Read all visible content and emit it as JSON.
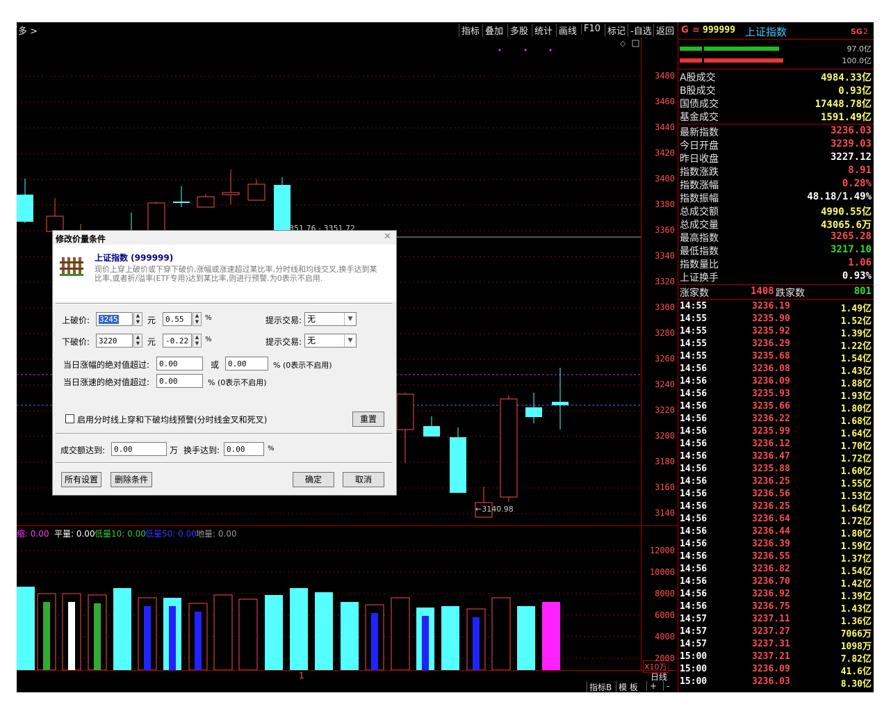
{
  "toolbar": {
    "crumb": "多 >",
    "items": [
      "指标",
      "叠加",
      "多股",
      "统计",
      "画线",
      "F10",
      "标记",
      "-自选",
      "返回"
    ]
  },
  "kchart": {
    "y_ticks": [
      "3480",
      "3460",
      "3440",
      "3420",
      "3400",
      "3380",
      "3360",
      "3340",
      "3320",
      "3300",
      "3280",
      "3260",
      "3240",
      "3220",
      "3200",
      "3180",
      "3160",
      "3140"
    ],
    "high_label": "3351.76 - 3351.72",
    "low_label": "←3140.98"
  },
  "volume": {
    "legend": [
      {
        "text": "缩: 0.00",
        "color": "#ff33ff"
      },
      {
        "text": "平量: 0.00",
        "color": "#ffffff"
      },
      {
        "text": "低量10: 0.00",
        "color": "#33cc33"
      },
      {
        "text": "低量50: 0.00",
        "color": "#3333ff"
      },
      {
        "text": "地量: 0.00",
        "color": "#999999"
      }
    ],
    "y_ticks": [
      "12000",
      "10000",
      "8000",
      "6000",
      "4000",
      "2000"
    ],
    "unit": "X10万"
  },
  "bottom": {
    "page_marker": "1",
    "period": "日线",
    "tabs": [
      "指标B",
      "模 板",
      "+",
      "-"
    ]
  },
  "panel": {
    "header_letter": "G",
    "header_menu": "≡",
    "code": "999999",
    "name": "上证指数",
    "badge": "SG",
    "badge_sub": "2",
    "bar1_value": "97.0亿",
    "bar2_value": "100.0亿",
    "turnover_rows": [
      {
        "label": "A股成交",
        "value": "4984.33亿",
        "color": "#ffff66"
      },
      {
        "label": "B股成交",
        "value": "0.93亿",
        "color": "#ffff66"
      },
      {
        "label": "国债成交",
        "value": "17448.78亿",
        "color": "#ffff66"
      },
      {
        "label": "基金成交",
        "value": "1591.49亿",
        "color": "#ffff66"
      }
    ],
    "stats_rows": [
      {
        "label": "最新指数",
        "value": "3236.03",
        "color": "#ff4d4d"
      },
      {
        "label": "今日开盘",
        "value": "3239.03",
        "color": "#ff4d4d"
      },
      {
        "label": "昨日收盘",
        "value": "3227.12",
        "color": "#ffffff"
      },
      {
        "label": "指数涨跌",
        "value": "8.91",
        "color": "#ff4d4d"
      },
      {
        "label": "指数涨幅",
        "value": "0.28%",
        "color": "#ff4d4d"
      },
      {
        "label": "指数振幅",
        "value": "48.18/1.49%",
        "color": "#ffffff"
      },
      {
        "label": "总成交额",
        "value": "4990.55亿",
        "color": "#ffff66"
      },
      {
        "label": "总成交量",
        "value": "43065.6万",
        "color": "#ffff66"
      },
      {
        "label": "最高指数",
        "value": "3265.28",
        "color": "#ff4d4d"
      },
      {
        "label": "最低指数",
        "value": "3217.10",
        "color": "#33dd33"
      },
      {
        "label": "指数量比",
        "value": "1.06",
        "color": "#ff4d4d"
      },
      {
        "label": "上证换手",
        "value": "0.93%",
        "color": "#ffffff"
      }
    ],
    "up_label": "涨家数",
    "up_count": "1408",
    "down_label": "跌家数",
    "down_count": "801",
    "ticks": [
      {
        "t": "14:55",
        "p": "3236.19",
        "v": "1.49亿"
      },
      {
        "t": "14:55",
        "p": "3235.90",
        "v": "1.52亿"
      },
      {
        "t": "14:55",
        "p": "3235.92",
        "v": "1.39亿"
      },
      {
        "t": "14:55",
        "p": "3236.29",
        "v": "1.22亿"
      },
      {
        "t": "14:55",
        "p": "3235.68",
        "v": "1.54亿"
      },
      {
        "t": "14:56",
        "p": "3236.08",
        "v": "1.43亿"
      },
      {
        "t": "14:56",
        "p": "3236.09",
        "v": "1.88亿"
      },
      {
        "t": "14:56",
        "p": "3235.93",
        "v": "1.93亿"
      },
      {
        "t": "14:56",
        "p": "3235.66",
        "v": "1.80亿"
      },
      {
        "t": "14:56",
        "p": "3236.22",
        "v": "1.68亿"
      },
      {
        "t": "14:56",
        "p": "3235.99",
        "v": "1.64亿"
      },
      {
        "t": "14:56",
        "p": "3236.12",
        "v": "1.70亿"
      },
      {
        "t": "14:56",
        "p": "3236.47",
        "v": "1.72亿"
      },
      {
        "t": "14:56",
        "p": "3235.88",
        "v": "1.60亿"
      },
      {
        "t": "14:56",
        "p": "3236.25",
        "v": "1.55亿"
      },
      {
        "t": "14:56",
        "p": "3236.56",
        "v": "1.53亿"
      },
      {
        "t": "14:56",
        "p": "3236.25",
        "v": "1.64亿"
      },
      {
        "t": "14:56",
        "p": "3236.64",
        "v": "1.72亿"
      },
      {
        "t": "14:56",
        "p": "3236.44",
        "v": "1.80亿"
      },
      {
        "t": "14:56",
        "p": "3236.39",
        "v": "1.59亿"
      },
      {
        "t": "14:56",
        "p": "3236.55",
        "v": "1.37亿"
      },
      {
        "t": "14:56",
        "p": "3236.82",
        "v": "1.54亿"
      },
      {
        "t": "14:56",
        "p": "3236.70",
        "v": "1.42亿"
      },
      {
        "t": "14:56",
        "p": "3236.92",
        "v": "1.39亿"
      },
      {
        "t": "14:56",
        "p": "3236.75",
        "v": "1.43亿"
      },
      {
        "t": "14:57",
        "p": "3237.11",
        "v": "1.36亿"
      },
      {
        "t": "14:57",
        "p": "3237.27",
        "v": "7066万"
      },
      {
        "t": "14:57",
        "p": "3237.31",
        "v": "1098万"
      },
      {
        "t": "15:00",
        "p": "3237.21",
        "v": "7.82亿"
      },
      {
        "t": "15:00",
        "p": "3236.09",
        "v": "41.6亿"
      },
      {
        "t": "15:00",
        "p": "3236.03",
        "v": "8.30亿"
      }
    ]
  },
  "dialog": {
    "title": "修改价量条件",
    "security": "上证指数 (999999)",
    "description": "现价上穿上破价或下穿下破价,涨幅或涨速超过某比率,分时线和均线交叉,换手达到某比率,或者折/溢率(ETF专用)达到某比率,则进行预警.为0表示不启用.",
    "upper_label": "上破价:",
    "upper_value": "3245",
    "upper_pct": "0.55",
    "lower_label": "下破价:",
    "lower_value": "3220",
    "lower_pct": "-0.22",
    "yuan": "元",
    "pct_sign": "%",
    "hint_label": "提示交易:",
    "hint_value": "无",
    "rise_label": "当日涨幅的绝对值超过:",
    "rise_value": "0.00",
    "or_label": "或",
    "rise_value2": "0.00",
    "rise_note": "% (0表示不启用)",
    "speed_label": "当日涨速的绝对值超过:",
    "speed_value": "0.00",
    "speed_note": "% (0表示不启用)",
    "cross_label": "启用分时线上穿和下破均线预警(分时线金叉和死叉)",
    "reset_button": "重置",
    "amount_label": "成交额达到:",
    "amount_value": "0.00",
    "amount_unit": "万",
    "turnover_label": "换手达到:",
    "turnover_value": "0.00",
    "all_settings_button": "所有设置",
    "delete_button": "删除条件",
    "ok_button": "确定",
    "cancel_button": "取消"
  }
}
